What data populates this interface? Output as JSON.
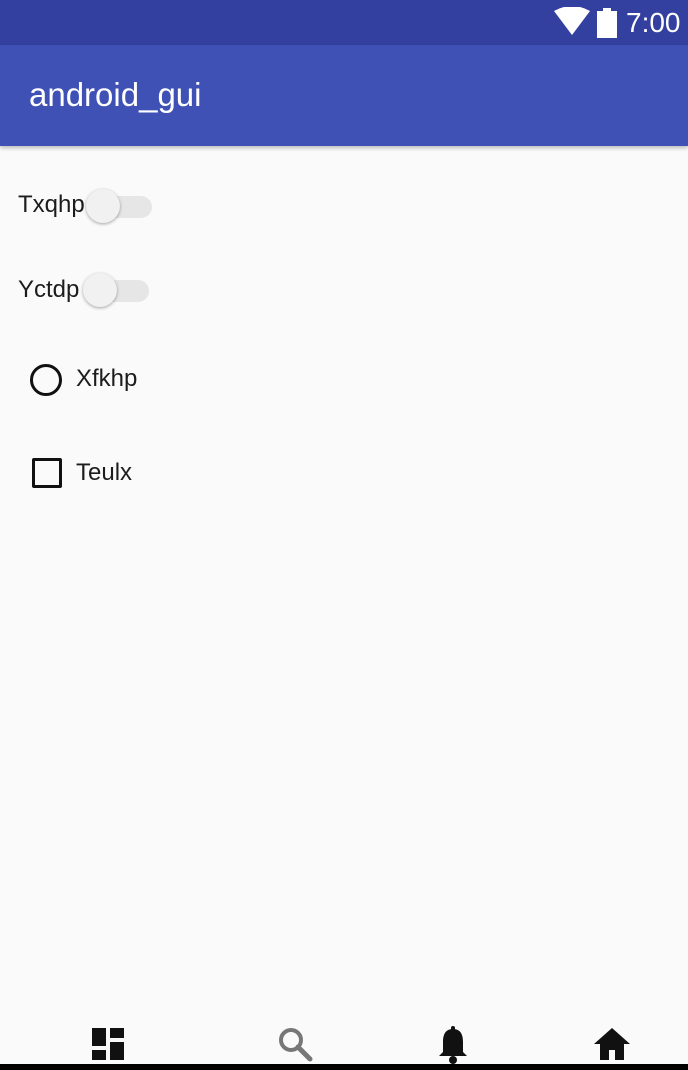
{
  "status_bar": {
    "time": "7:00",
    "icons": [
      "wifi-icon",
      "battery-icon"
    ]
  },
  "app_bar": {
    "title": "android_gui"
  },
  "switches": [
    {
      "label": "Txqhp",
      "checked": false
    },
    {
      "label": "Yctdp",
      "checked": false
    }
  ],
  "radio": {
    "label": "Xfkhp",
    "checked": false
  },
  "checkbox": {
    "label": "Teulx",
    "checked": false
  },
  "bottom_nav": {
    "items": [
      {
        "icon": "dashboard-icon"
      },
      {
        "icon": "search-icon"
      },
      {
        "icon": "notifications-icon"
      },
      {
        "icon": "home-icon"
      }
    ]
  },
  "colors": {
    "status_bar": "#3340a0",
    "app_bar": "#3f51b5",
    "background": "#fafafa"
  }
}
